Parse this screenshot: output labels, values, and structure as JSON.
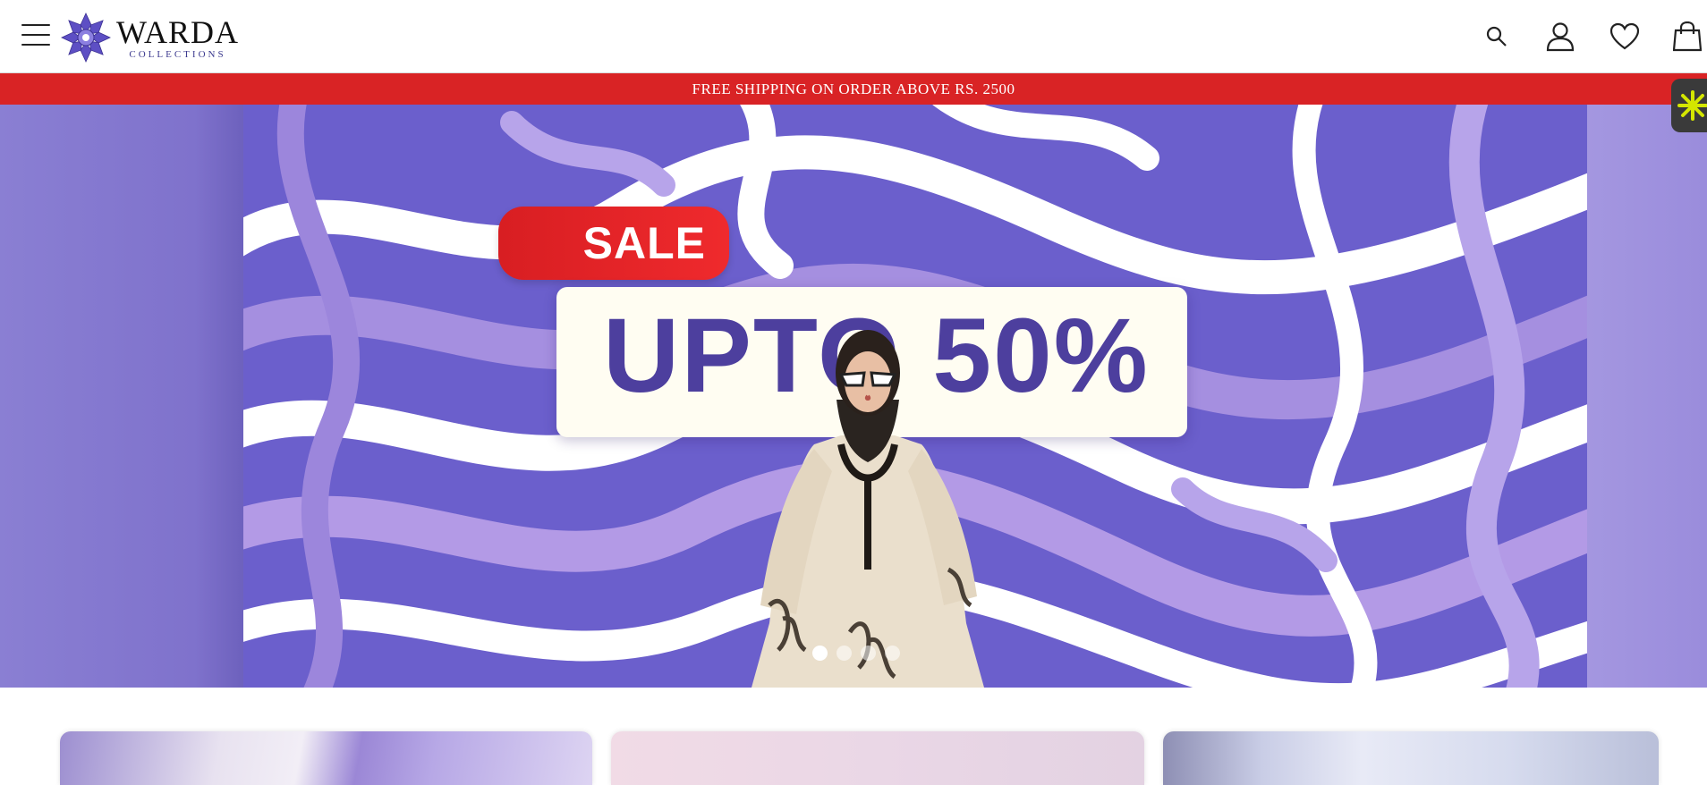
{
  "header": {
    "brand_name": "WARDA",
    "brand_sub": "COLLECTIONS",
    "icons": [
      "menu-icon",
      "search-icon",
      "user-icon",
      "heart-icon",
      "bag-icon"
    ]
  },
  "announcement": {
    "text": "FREE SHIPPING ON ORDER ABOVE RS. 2500"
  },
  "hero": {
    "sale_label": "SALE",
    "discount_label": "UPTO 50%",
    "slide_count": 4,
    "active_slide": 1
  },
  "colors": {
    "announcement_bg": "#d92325",
    "hero_purple": "#6f5fcf",
    "brand_accent": "#4d3f9e",
    "sale_red": "#e02528"
  }
}
